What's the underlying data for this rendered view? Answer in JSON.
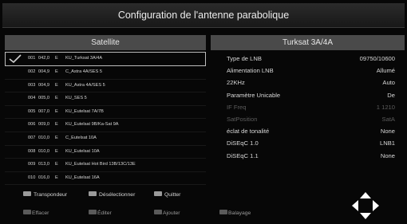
{
  "title": "Configuration de l'antenne parabolique",
  "satellite_panel": {
    "header": "Satellite",
    "rows": [
      {
        "num": "001",
        "pos": "042,0",
        "dir": "E",
        "name": "KU_Turksat 3A/4A",
        "selected": true
      },
      {
        "num": "002",
        "pos": "004,9",
        "dir": "E",
        "name": "C_Astra 4A/SES 5"
      },
      {
        "num": "003",
        "pos": "004,9",
        "dir": "E",
        "name": "KU_Astra 4A/SES 5"
      },
      {
        "num": "004",
        "pos": "005,0",
        "dir": "E",
        "name": "KU_SES 5"
      },
      {
        "num": "005",
        "pos": "007,0",
        "dir": "E",
        "name": "KU_Eutelsat 7A/7B"
      },
      {
        "num": "006",
        "pos": "009,0",
        "dir": "E",
        "name": "KU_Eutelsat 9B/Ka-Sat 9A"
      },
      {
        "num": "007",
        "pos": "010,0",
        "dir": "E",
        "name": "C_Eutelsat 10A"
      },
      {
        "num": "008",
        "pos": "010,0",
        "dir": "E",
        "name": "KU_Eutelsat 10A"
      },
      {
        "num": "009",
        "pos": "013,0",
        "dir": "E",
        "name": "KU_Eutelsat Hot Bird 13B/13C/13E"
      },
      {
        "num": "010",
        "pos": "016,0",
        "dir": "E",
        "name": "KU_Eutelsat 16A"
      }
    ]
  },
  "details_panel": {
    "header": "Turksat 3A/4A",
    "rows": [
      {
        "label": "Type de LNB",
        "value": "09750/10600",
        "dim": false
      },
      {
        "label": "Alimentation LNB",
        "value": "Allumé",
        "dim": false
      },
      {
        "label": "22KHz",
        "value": "Auto",
        "dim": false
      },
      {
        "label": "Paramètre Unicable",
        "value": "De",
        "dim": false
      },
      {
        "label": "IF Freq",
        "value": "1 1210",
        "dim": true
      },
      {
        "label": "SatPosition",
        "value": "SatA",
        "dim": true
      },
      {
        "label": "éclat de tonalité",
        "value": "None",
        "dim": false
      },
      {
        "label": "DiSEqC 1.0",
        "value": "LNB1",
        "dim": false
      },
      {
        "label": "DiSEqC 1.1",
        "value": "None",
        "dim": false
      }
    ]
  },
  "bottom_bar": {
    "transpondeur": "Transpondeur",
    "deselectionner": "Désélectionner",
    "quitter": "Quitter",
    "effacer": "Effacer",
    "editer": "Éditer",
    "ajouter": "Ajouter",
    "balayage": "Balayage"
  },
  "colors": {
    "background": "#070707",
    "header_panel": "#4a4a4a",
    "dim_text": "#5c5c5c"
  }
}
